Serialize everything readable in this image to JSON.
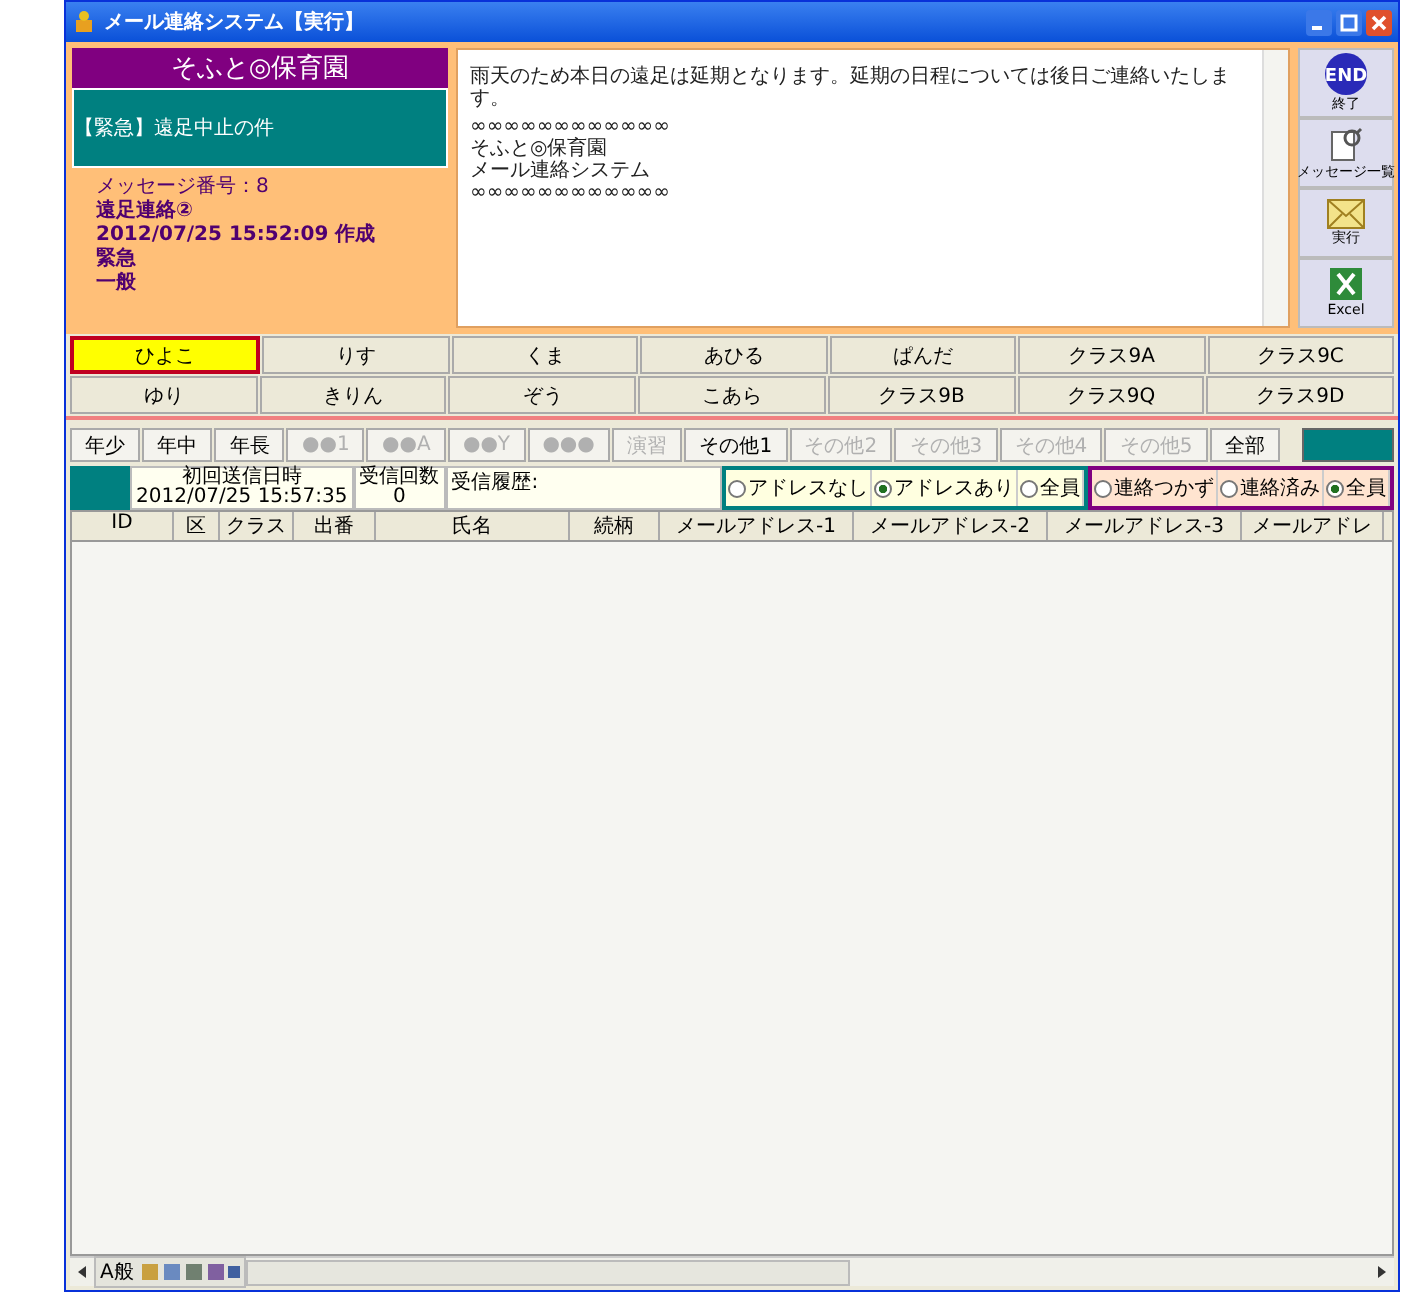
{
  "window": {
    "title": "メール連絡システム【実行】"
  },
  "message_card": {
    "school": "そふと◎保育園",
    "subject": "【緊急】遠足中止の件",
    "info": [
      "メッセージ番号：8",
      "遠足連絡②",
      "2012/07/25 15:52:09 作成",
      "緊急",
      "一般"
    ]
  },
  "message_body": [
    "雨天のため本日の遠足は延期となります。延期の日程については後日ご連絡いたします。",
    "∞∞∞∞∞∞∞∞∞∞∞∞",
    "そふと◎保育園",
    "メール連絡システム",
    "∞∞∞∞∞∞∞∞∞∞∞∞"
  ],
  "side_buttons": [
    {
      "kind": "end",
      "icon_text": "END",
      "label": "終了"
    },
    {
      "kind": "list",
      "label": "メッセージ一覧"
    },
    {
      "kind": "mail",
      "label": "実行"
    },
    {
      "kind": "excel",
      "label": "Excel"
    }
  ],
  "class_buttons": [
    [
      {
        "label": "ひよこ",
        "selected": true
      },
      {
        "label": "りす",
        "selected": false
      },
      {
        "label": "くま",
        "selected": false
      },
      {
        "label": "あひる",
        "selected": false
      },
      {
        "label": "ぱんだ",
        "selected": false
      },
      {
        "label": "クラス9A",
        "selected": false
      },
      {
        "label": "クラス9C",
        "selected": false
      }
    ],
    [
      {
        "label": "ゆり",
        "selected": false
      },
      {
        "label": "きりん",
        "selected": false
      },
      {
        "label": "ぞう",
        "selected": false
      },
      {
        "label": "こあら",
        "selected": false
      },
      {
        "label": "クラス9B",
        "selected": false
      },
      {
        "label": "クラス9Q",
        "selected": false
      },
      {
        "label": "クラス9D",
        "selected": false
      }
    ]
  ],
  "filter_buttons": [
    {
      "label": "年少",
      "disabled": false
    },
    {
      "label": "年中",
      "disabled": false
    },
    {
      "label": "年長",
      "disabled": false
    },
    {
      "label": "●●1",
      "disabled": true
    },
    {
      "label": "●●A",
      "disabled": true
    },
    {
      "label": "●●Y",
      "disabled": true
    },
    {
      "label": "●●●",
      "disabled": true
    },
    {
      "label": "演習",
      "disabled": true
    },
    {
      "label": "その他1",
      "disabled": false
    },
    {
      "label": "その他2",
      "disabled": true
    },
    {
      "label": "その他3",
      "disabled": true
    },
    {
      "label": "その他4",
      "disabled": true
    },
    {
      "label": "その他5",
      "disabled": true
    },
    {
      "label": "全部",
      "disabled": false
    }
  ],
  "send_info": {
    "first_sent_label": "初回送信日時",
    "first_sent_value": "2012/07/25 15:57:35",
    "count_label": "受信回数",
    "count_value": "0",
    "history_label": "受信履歴:"
  },
  "address_filter": [
    {
      "label": "アドレスなし",
      "selected": false
    },
    {
      "label": "アドレスあり",
      "selected": true
    },
    {
      "label": "全員",
      "selected": false
    }
  ],
  "contact_filter": [
    {
      "label": "連絡つかず",
      "selected": false
    },
    {
      "label": "連絡済み",
      "selected": false
    },
    {
      "label": "全員",
      "selected": true
    }
  ],
  "table": {
    "columns": [
      "ID",
      "区",
      "クラス",
      "出番",
      "氏名",
      "続柄",
      "メールアドレス-1",
      "メールアドレス-2",
      "メールアドレス-3",
      "メールアドレ"
    ]
  },
  "language_bar": {
    "label": "A般"
  }
}
